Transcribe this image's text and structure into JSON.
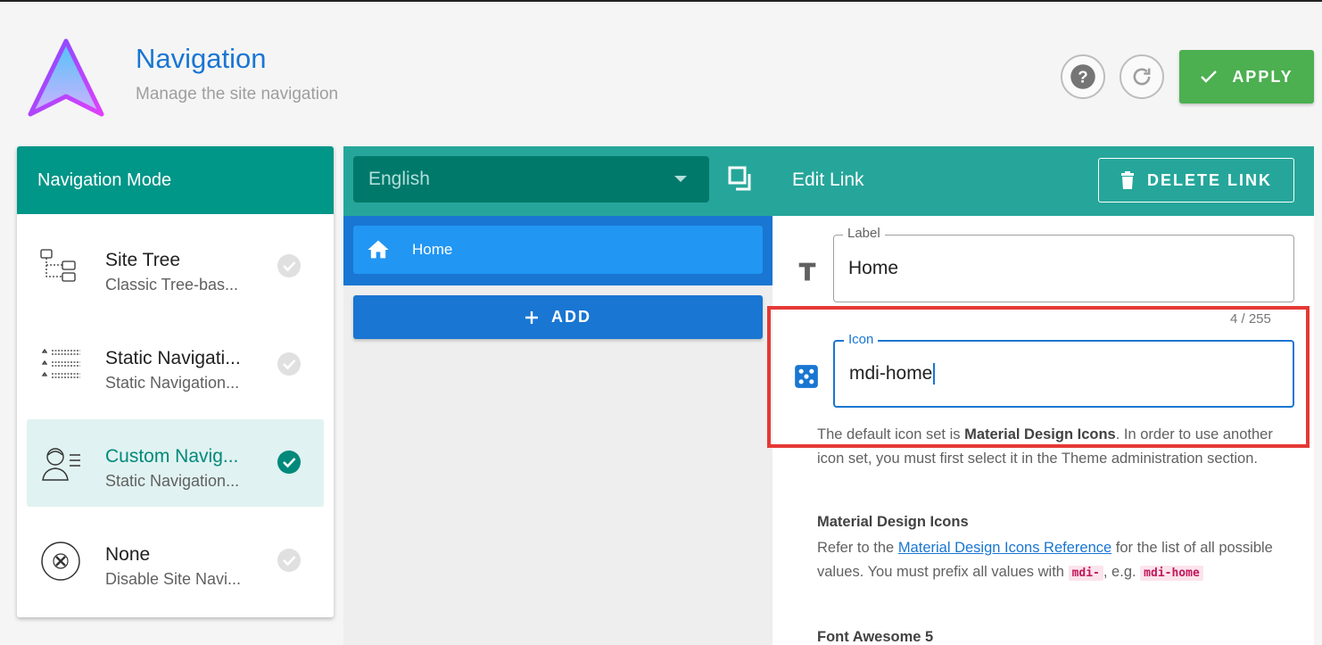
{
  "header": {
    "title": "Navigation",
    "subtitle": "Manage the site navigation",
    "help_icon": "help-circle-icon",
    "refresh_icon": "refresh-icon",
    "apply_label": "APPLY"
  },
  "mode_panel": {
    "title": "Navigation Mode",
    "items": [
      {
        "title": "Site Tree",
        "desc": "Classic Tree-bas...",
        "icon": "site-tree-icon",
        "selected": false
      },
      {
        "title": "Static Navigati...",
        "desc": "Static Navigation...",
        "icon": "static-list-icon",
        "selected": false
      },
      {
        "title": "Custom Navig...",
        "desc": "Static Navigation...",
        "icon": "user-list-icon",
        "selected": true
      },
      {
        "title": "None",
        "desc": "Disable Site Navi...",
        "icon": "none-circle-x-icon",
        "selected": false
      }
    ]
  },
  "toolbar": {
    "locale": "English",
    "edit_label": "Edit Link",
    "delete_label": "DELETE LINK"
  },
  "tree": {
    "items": [
      {
        "label": "Home",
        "icon": "home-icon"
      }
    ],
    "add_label": "ADD"
  },
  "editor": {
    "label_field": {
      "label": "Label",
      "value": "Home",
      "counter": "4 / 255"
    },
    "icon_field": {
      "label": "Icon",
      "value": "mdi-home"
    },
    "help": {
      "p1_a": "The default icon set is ",
      "p1_b": "Material Design Icons",
      "p1_c": ". In order to use another icon set, you must first select it in the Theme administration section.",
      "h2": "Material Design Icons",
      "p2_a": "Refer to the ",
      "p2_link": "Material Design Icons Reference",
      "p2_b": " for the list of all possible values. You must prefix all values with ",
      "p2_code1": "mdi-",
      "p2_c": ", e.g. ",
      "p2_code2": "mdi-home",
      "h3": "Font Awesome 5"
    }
  },
  "colors": {
    "teal": "#009688",
    "blue": "#1976d2",
    "green": "#4caf50",
    "highlight": "#e53935"
  }
}
